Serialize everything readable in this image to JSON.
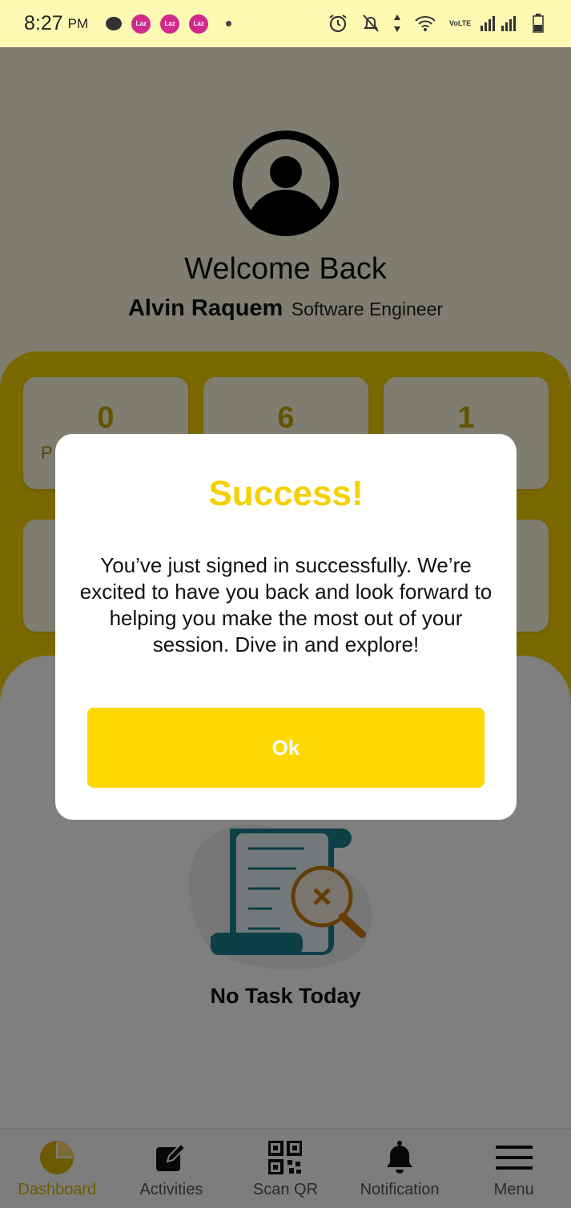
{
  "status_bar": {
    "time": "8:27",
    "ampm": "PM",
    "app_icon_text": "Laz",
    "network_label": "VoLTE",
    "icons": [
      "chat-bubble-icon",
      "app-notification-icon",
      "alarm-icon",
      "notifications-off-icon",
      "data-arrows-icon",
      "wifi-icon",
      "signal-icon",
      "battery-icon"
    ]
  },
  "header": {
    "welcome": "Welcome Back",
    "user_name": "Alvin Raquem",
    "user_role": "Software Engineer"
  },
  "stats": [
    {
      "value": "0",
      "label": "P"
    },
    {
      "value": "6",
      "label": ""
    },
    {
      "value": "1",
      "label": ""
    },
    {
      "value": "",
      "label": ""
    },
    {
      "value": "",
      "label": ""
    },
    {
      "value": "",
      "label": ""
    }
  ],
  "empty_state": {
    "text": "No Task Today"
  },
  "dialog": {
    "title": "Success!",
    "message": "You’ve just signed in successfully. We’re excited to have you back and look forward to helping you make the most out of your session. Dive in and explore!",
    "ok_label": "Ok"
  },
  "bottom_nav": {
    "items": [
      {
        "label": "Dashboard",
        "icon": "pie-chart-icon",
        "active": true
      },
      {
        "label": "Activities",
        "icon": "edit-icon",
        "active": false
      },
      {
        "label": "Scan QR",
        "icon": "qr-code-icon",
        "active": false
      },
      {
        "label": "Notification",
        "icon": "bell-icon",
        "active": false
      },
      {
        "label": "Menu",
        "icon": "hamburger-menu-icon",
        "active": false
      }
    ]
  },
  "colors": {
    "accent": "#f6d000",
    "button": "#fdd700",
    "status_bar": "#fefab4",
    "primary_teal": "#1a7f8c"
  }
}
